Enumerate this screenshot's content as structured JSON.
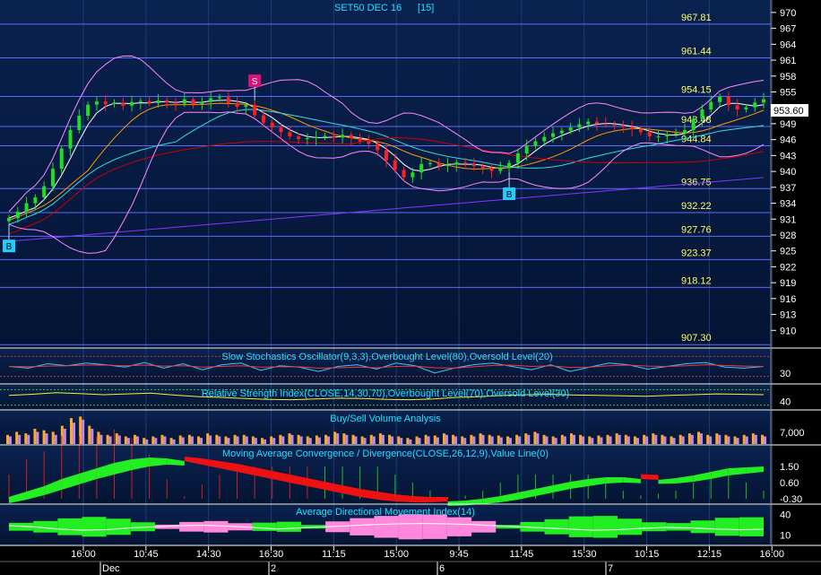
{
  "header": {
    "symbol": "SET50 DEC 16",
    "interval": "[15]"
  },
  "colors": {
    "bg_top": "#0a1f44",
    "bg_bottom": "#04102a",
    "hline": "#5a6cff",
    "bull": "#22dd22",
    "bear": "#ff2020",
    "title": "#22e0ff",
    "level_text": "#ffff66",
    "axis_text": "#ffffff"
  },
  "chart_data": [
    {
      "type": "candlestick",
      "title": "SET50 DEC 16  [15]",
      "ylim": [
        907,
        971
      ],
      "y_ticks": [
        "970",
        "967",
        "964",
        "961",
        "958",
        "955",
        "952",
        "949",
        "946",
        "943",
        "940",
        "937",
        "934",
        "931",
        "928",
        "925",
        "922",
        "919",
        "916",
        "913",
        "910"
      ],
      "last_price": "953.60",
      "horizontal_levels": [
        "967.81",
        "961.44",
        "954.15",
        "948.48",
        "944.84",
        "936.75",
        "932.22",
        "927.76",
        "923.37",
        "918.12",
        "907.30"
      ],
      "signals": [
        {
          "label": "B",
          "type": "buy",
          "x": "16:00 (Dec)"
        },
        {
          "label": "S",
          "type": "sell",
          "x": "16:30 (2)"
        },
        {
          "label": "B",
          "type": "buy",
          "x": "11:45 (6)"
        }
      ],
      "close": [
        931.2,
        932.4,
        934.0,
        935.1,
        937.2,
        940.5,
        944.3,
        947.8,
        950.5,
        952.6,
        953.2,
        952.7,
        953.0,
        952.4,
        953.1,
        953.3,
        952.9,
        953.4,
        953.0,
        952.8,
        953.6,
        952.7,
        953.1,
        953.8,
        954.0,
        952.9,
        952.2,
        952.5,
        950.6,
        949.2,
        948.3,
        947.4,
        946.6,
        946.1,
        946.3,
        946.5,
        946.7,
        946.4,
        946.9,
        946.3,
        945.7,
        945.2,
        944.0,
        942.1,
        940.3,
        938.9,
        939.8,
        941.4,
        941.6,
        941.0,
        941.3,
        941.7,
        941.4,
        941.0,
        940.6,
        940.1,
        940.7,
        941.6,
        943.4,
        944.8,
        945.7,
        946.5,
        947.2,
        947.7,
        948.3,
        948.9,
        949.4,
        949.0,
        948.9,
        948.7,
        948.4,
        948.0,
        947.4,
        946.6,
        946.6,
        947.0,
        947.2,
        947.8,
        949.9,
        951.7,
        953.1,
        954.1,
        952.5,
        951.7,
        952.1,
        953.0,
        953.6
      ],
      "series": [
        {
          "name": "SMA short",
          "color": "#ffffff"
        },
        {
          "name": "SMA medium",
          "color": "#ff9900"
        },
        {
          "name": "SMA long",
          "color": "#33dddd"
        },
        {
          "name": "SMA longer",
          "color": "#cc0000"
        },
        {
          "name": "SMA longest",
          "color": "#8833ff"
        },
        {
          "name": "Bollinger Bands",
          "color": "#ff88ff"
        }
      ]
    },
    {
      "type": "line",
      "title": "Slow Stochastics Oscillator(9,3,3),Overbought Level(80),Oversold Level(20)",
      "y_ticks": [
        "30"
      ],
      "k": [
        50,
        45,
        58,
        52,
        60,
        55,
        48,
        62,
        45,
        58,
        40,
        55,
        60,
        38,
        52,
        48,
        35,
        50,
        55,
        42,
        60,
        52,
        30,
        45,
        55,
        60,
        50,
        40,
        55,
        35,
        48,
        60,
        55,
        42,
        50,
        58,
        62,
        48,
        45,
        50
      ],
      "d": [
        50,
        49,
        51,
        52,
        54,
        54,
        52,
        54,
        51,
        52,
        48,
        50,
        52,
        48,
        49,
        49,
        45,
        46,
        48,
        46,
        50,
        51,
        46,
        45,
        49,
        53,
        54,
        50,
        52,
        47,
        48,
        52,
        54,
        51,
        50,
        52,
        55,
        53,
        51,
        50
      ]
    },
    {
      "type": "line",
      "title": "Relative Strength Index(CLOSE,14,30,70),Overbought Level(70),Oversold Level(30)",
      "y_ticks": [
        "40"
      ],
      "rsi": [
        55,
        58,
        62,
        60,
        57,
        59,
        61,
        56,
        52,
        50,
        47,
        45,
        44,
        46,
        48,
        47,
        45,
        44,
        46,
        50,
        52,
        55,
        57,
        58,
        56,
        55,
        54,
        53,
        55,
        57,
        59,
        58,
        57
      ]
    },
    {
      "type": "bar",
      "title": "Buy/Sell Volume Analysis",
      "y_ticks": [
        "7,000"
      ],
      "buy": [
        0.3,
        0.4,
        0.35,
        0.5,
        0.45,
        0.4,
        0.6,
        0.85,
        0.9,
        0.6,
        0.4,
        0.3,
        0.35,
        0.25,
        0.3,
        0.2,
        0.25,
        0.3,
        0.2,
        0.28,
        0.3,
        0.25,
        0.35,
        0.3,
        0.25,
        0.3,
        0.3,
        0.25,
        0.2,
        0.25,
        0.3,
        0.35,
        0.3,
        0.25,
        0.28,
        0.3,
        0.4,
        0.35,
        0.3,
        0.25,
        0.3,
        0.35,
        0.3,
        0.25,
        0.2,
        0.25,
        0.3,
        0.28,
        0.35,
        0.3,
        0.25,
        0.3,
        0.35,
        0.3,
        0.28,
        0.25,
        0.3,
        0.35,
        0.4,
        0.3,
        0.25,
        0.3,
        0.35,
        0.3,
        0.25,
        0.28,
        0.3,
        0.35,
        0.3,
        0.25,
        0.3,
        0.35,
        0.3,
        0.25,
        0.3,
        0.35,
        0.4,
        0.3,
        0.35,
        0.3,
        0.25,
        0.3,
        0.35,
        0.3
      ],
      "sell": [
        0.25,
        0.3,
        0.3,
        0.4,
        0.35,
        0.3,
        0.5,
        0.7,
        0.8,
        0.5,
        0.3,
        0.25,
        0.28,
        0.2,
        0.25,
        0.15,
        0.2,
        0.25,
        0.15,
        0.22,
        0.25,
        0.2,
        0.28,
        0.25,
        0.2,
        0.25,
        0.25,
        0.2,
        0.15,
        0.2,
        0.25,
        0.3,
        0.25,
        0.2,
        0.22,
        0.25,
        0.35,
        0.3,
        0.25,
        0.2,
        0.25,
        0.3,
        0.25,
        0.2,
        0.15,
        0.2,
        0.25,
        0.22,
        0.3,
        0.25,
        0.2,
        0.25,
        0.3,
        0.25,
        0.22,
        0.2,
        0.25,
        0.3,
        0.35,
        0.25,
        0.2,
        0.25,
        0.3,
        0.25,
        0.2,
        0.22,
        0.25,
        0.3,
        0.25,
        0.2,
        0.25,
        0.3,
        0.25,
        0.2,
        0.25,
        0.3,
        0.35,
        0.25,
        0.3,
        0.25,
        0.2,
        0.25,
        0.3,
        0.25
      ]
    },
    {
      "type": "area",
      "title": "Moving Average Convergence / Divergence(CLOSE,26,12,9),Value Line(0)",
      "y_ticks": [
        "1.50",
        "0.60",
        "-0.30"
      ],
      "macd": [
        -0.2,
        0.1,
        0.4,
        0.8,
        1.1,
        1.4,
        1.7,
        1.9,
        2.0,
        1.95,
        1.8,
        1.6,
        1.4,
        1.2,
        1.0,
        0.8,
        0.6,
        0.4,
        0.2,
        0.0,
        -0.2,
        -0.35,
        -0.45,
        -0.5,
        -0.5,
        -0.45,
        -0.4,
        -0.3,
        -0.15,
        0.05,
        0.25,
        0.45,
        0.65,
        0.8,
        0.9,
        0.9,
        0.8,
        0.75,
        0.85,
        1.0,
        1.2,
        1.4,
        1.45,
        1.5
      ],
      "signal": [
        -0.3,
        -0.1,
        0.15,
        0.45,
        0.75,
        1.05,
        1.3,
        1.55,
        1.75,
        1.85,
        1.8,
        1.7,
        1.55,
        1.4,
        1.2,
        1.0,
        0.8,
        0.6,
        0.4,
        0.2,
        0.0,
        -0.15,
        -0.3,
        -0.4,
        -0.45,
        -0.45,
        -0.42,
        -0.35,
        -0.25,
        -0.1,
        0.1,
        0.3,
        0.5,
        0.65,
        0.8,
        0.85,
        0.82,
        0.78,
        0.8,
        0.9,
        1.05,
        1.25,
        1.35,
        1.45
      ]
    },
    {
      "type": "area",
      "title": "Average Directional Movement Index(14)",
      "y_ticks": [
        "40",
        "10"
      ],
      "plus_di": [
        20,
        25,
        35,
        40,
        38,
        30,
        25,
        20,
        18,
        22,
        28,
        35,
        30,
        25,
        20,
        15,
        12,
        10,
        12,
        15,
        20,
        25,
        30,
        35,
        40,
        38,
        32,
        28,
        30,
        35,
        38,
        36
      ],
      "minus_di": [
        15,
        18,
        20,
        18,
        15,
        18,
        22,
        25,
        30,
        32,
        28,
        22,
        25,
        30,
        35,
        38,
        40,
        42,
        38,
        32,
        25,
        20,
        18,
        15,
        12,
        15,
        20,
        25,
        22,
        18,
        15,
        16
      ]
    }
  ],
  "x_axis": {
    "time_labels": [
      "16:00",
      "10:45",
      "14:30",
      "16:30",
      "11:15",
      "15:00",
      "9:45",
      "11:45",
      "15:30",
      "10:15",
      "12:15",
      "16:00"
    ],
    "date_labels": [
      "Dec",
      "2",
      "6",
      "7"
    ]
  }
}
